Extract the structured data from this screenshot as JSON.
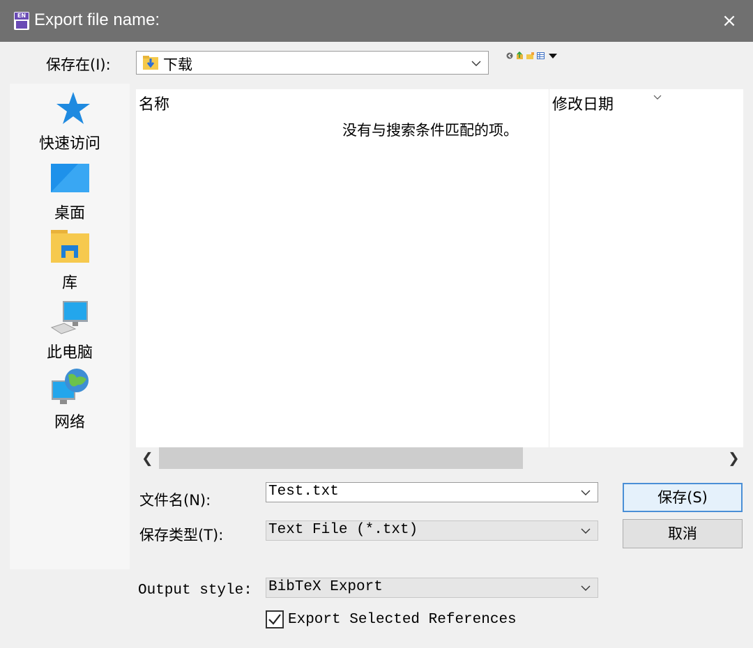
{
  "window": {
    "title": "Export file name:",
    "close_glyph": "×",
    "app_icon_text": "EN"
  },
  "save_in": {
    "label": "保存在(I):",
    "folder": "下载"
  },
  "toolbar": {
    "icons": [
      "back-icon",
      "up-folder-icon",
      "new-folder-icon",
      "view-menu-icon"
    ]
  },
  "places": [
    {
      "label": "快速访问",
      "icon": "star-icon"
    },
    {
      "label": "桌面",
      "icon": "desktop-icon"
    },
    {
      "label": "库",
      "icon": "library-folder-icon"
    },
    {
      "label": "此电脑",
      "icon": "computer-icon"
    },
    {
      "label": "网络",
      "icon": "network-globe-icon"
    }
  ],
  "file_list": {
    "col_name": "名称",
    "col_modified": "修改日期",
    "empty_message": "没有与搜索条件匹配的项。"
  },
  "filename": {
    "label": "文件名(N):",
    "value": "Test.txt"
  },
  "filetype": {
    "label": "保存类型(T):",
    "value": "Text File (*.txt)"
  },
  "output_style": {
    "label": "Output style:",
    "value": "BibTeX Export"
  },
  "export_selected": {
    "label": "Export Selected References",
    "checked": true
  },
  "buttons": {
    "save": "保存(S)",
    "cancel": "取消"
  },
  "colors": {
    "titlebar": "#707070",
    "accent": "#4a8fd6",
    "app_icon": "#6a4bb5"
  }
}
